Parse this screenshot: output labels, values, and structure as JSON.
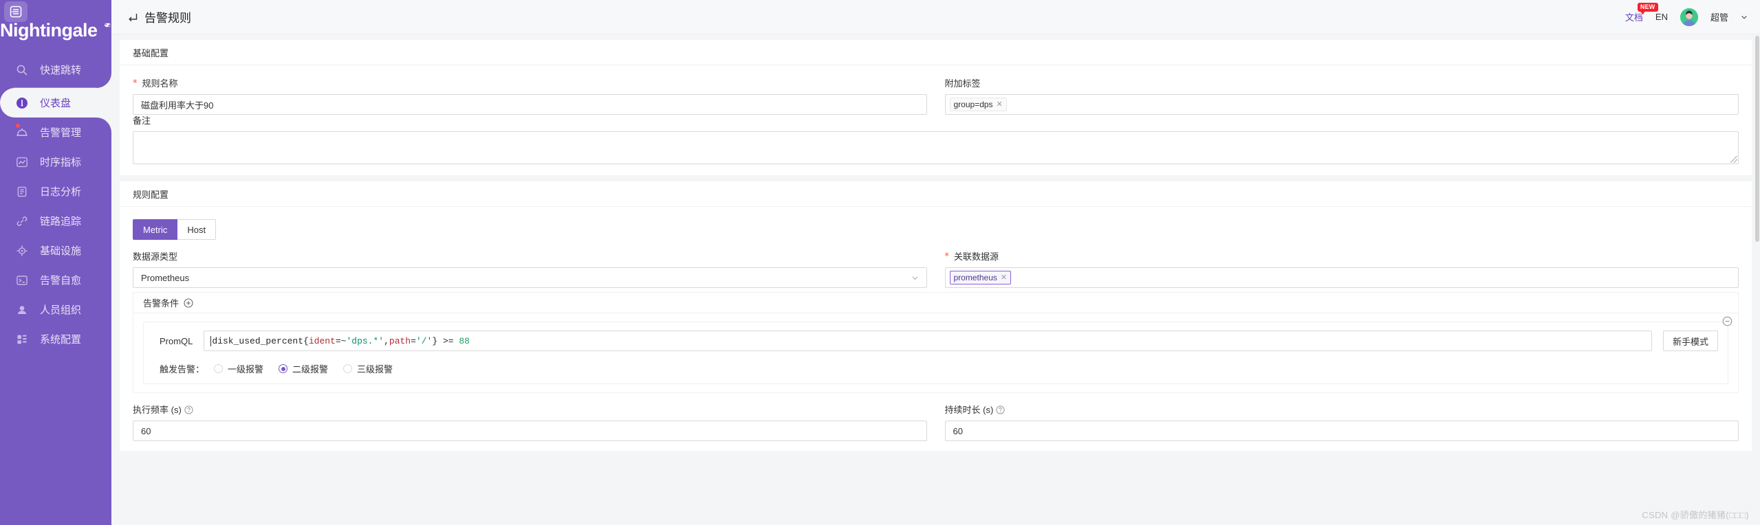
{
  "brand": {
    "name": "Nightingale",
    "logo_icon": "bird-logo-icon"
  },
  "sidebar": {
    "collapse_icon": "menu-collapse-icon",
    "items": [
      {
        "label": "快速跳转",
        "icon": "search-icon",
        "active": false,
        "badge": false
      },
      {
        "label": "仪表盘",
        "icon": "dashboard-gauge-icon",
        "active": true,
        "badge": false
      },
      {
        "label": "告警管理",
        "icon": "alarm-bell-icon",
        "active": false,
        "badge": true
      },
      {
        "label": "时序指标",
        "icon": "line-chart-icon",
        "active": false,
        "badge": false
      },
      {
        "label": "日志分析",
        "icon": "document-log-icon",
        "active": false,
        "badge": false
      },
      {
        "label": "链路追踪",
        "icon": "link-trace-icon",
        "active": false,
        "badge": false
      },
      {
        "label": "基础设施",
        "icon": "target-crosshair-icon",
        "active": false,
        "badge": false
      },
      {
        "label": "告警自愈",
        "icon": "terminal-icon",
        "active": false,
        "badge": false
      },
      {
        "label": "人员组织",
        "icon": "user-icon",
        "active": false,
        "badge": false
      },
      {
        "label": "系统配置",
        "icon": "grid-blocks-icon",
        "active": false,
        "badge": false
      }
    ]
  },
  "topbar": {
    "back_icon": "back-arrow-icon",
    "title": "告警规则",
    "doc_label": "文档",
    "new_badge": "NEW",
    "lang": "EN",
    "user_name": "超管",
    "chevron_icon": "chevron-down-icon",
    "avatar_icon": "user-avatar"
  },
  "basic_section": {
    "heading": "基础配置",
    "rule_name": {
      "label": "规则名称",
      "required": true,
      "value": "磁盘利用率大于90"
    },
    "extra_tags": {
      "label": "附加标签",
      "required": false,
      "tags": [
        {
          "text": "group=dps",
          "close_icon": "close-icon"
        }
      ]
    },
    "note": {
      "label": "备注",
      "value": ""
    }
  },
  "rule_section": {
    "heading": "规则配置",
    "tabs": [
      {
        "label": "Metric",
        "active": true
      },
      {
        "label": "Host",
        "active": false
      }
    ],
    "datasource_type": {
      "label": "数据源类型",
      "value": "Prometheus",
      "arrow_icon": "chevron-down-icon"
    },
    "related_datasource": {
      "label": "关联数据源",
      "required": true,
      "tags": [
        {
          "text": "prometheus",
          "close_icon": "close-icon"
        }
      ]
    },
    "alert_conditions": {
      "heading": "告警条件",
      "add_icon": "plus-circle-icon",
      "remove_icon": "minus-circle-icon",
      "promql": {
        "label": "PromQL",
        "tokens": [
          {
            "t": "disk_used_percent",
            "k": "metric"
          },
          {
            "t": "{",
            "k": "brace"
          },
          {
            "t": "ident",
            "k": "label"
          },
          {
            "t": "=~",
            "k": "op"
          },
          {
            "t": "'dps.*'",
            "k": "str"
          },
          {
            "t": ",",
            "k": "op"
          },
          {
            "t": "path",
            "k": "label"
          },
          {
            "t": "=",
            "k": "op"
          },
          {
            "t": "'/'",
            "k": "str"
          },
          {
            "t": "}",
            "k": "brace"
          },
          {
            "t": " >= ",
            "k": "op"
          },
          {
            "t": "88",
            "k": "num"
          }
        ],
        "plain": "disk_used_percent{ident=~'dps.*',path='/'} >= 88",
        "beginner_mode_button": "新手模式"
      },
      "trigger": {
        "label": "触发告警：",
        "options": [
          {
            "label": "一级报警",
            "selected": false
          },
          {
            "label": "二级报警",
            "selected": true
          },
          {
            "label": "三级报警",
            "selected": false
          }
        ]
      }
    },
    "exec_frequency": {
      "label": "执行频率 (s)",
      "help_icon": "question-circle-icon",
      "value": "60"
    },
    "duration": {
      "label": "持续时长 (s)",
      "help_icon": "question-circle-icon",
      "value": "60"
    }
  },
  "watermark": "CSDN @骄傲的猪猪(□□□)",
  "colors": {
    "brand_purple": "#7759c2",
    "accent": "#6a42c1",
    "danger": "#ff4d4f"
  }
}
